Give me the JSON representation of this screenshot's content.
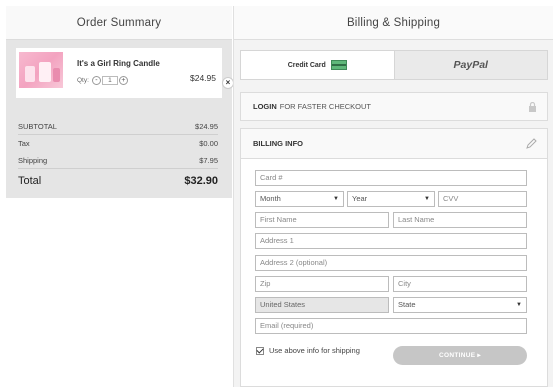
{
  "order_summary": {
    "title": "Order Summary",
    "item": {
      "name": "It's a Girl Ring Candle",
      "qty_label": "Qty:",
      "qty_value": "1",
      "qty_minus": "-",
      "qty_plus": "+",
      "price": "$24.95",
      "remove_label": "×"
    },
    "totals": {
      "subtotal_label": "SUBTOTAL",
      "subtotal_value": "$24.95",
      "tax_label": "Tax",
      "tax_value": "$0.00",
      "shipping_label": "Shipping",
      "shipping_value": "$7.95",
      "total_label": "Total",
      "total_value": "$32.90"
    }
  },
  "billing_shipping": {
    "title": "Billing & Shipping",
    "tabs": {
      "credit_card": "Credit Card",
      "paypal": "PayPal"
    },
    "login": {
      "bold": "LOGIN",
      "rest": "FOR FASTER CHECKOUT"
    },
    "billing_info": {
      "title": "BILLING INFO",
      "card_placeholder": "Card #",
      "month": "Month",
      "year": "Year",
      "cvv_placeholder": "CVV",
      "first_name_placeholder": "First Name",
      "last_name_placeholder": "Last Name",
      "address1_placeholder": "Address 1",
      "address2_placeholder": "Address 2 (optional)",
      "zip_placeholder": "Zip",
      "city_placeholder": "City",
      "country": "United States",
      "state": "State",
      "email_placeholder": "Email (required)",
      "ship_checkbox_label": "Use above info for shipping",
      "continue_label": "CONTINUE ▸"
    }
  },
  "colors": {
    "summary_bg": "#e5e5e5",
    "continue_button": "#c6c6c6",
    "card_icon": "#5fb87a"
  },
  "icons": [
    "credit-card-icon",
    "lock-icon",
    "pencil-icon",
    "close-icon",
    "checkmark-icon",
    "chevron-down-icon"
  ]
}
